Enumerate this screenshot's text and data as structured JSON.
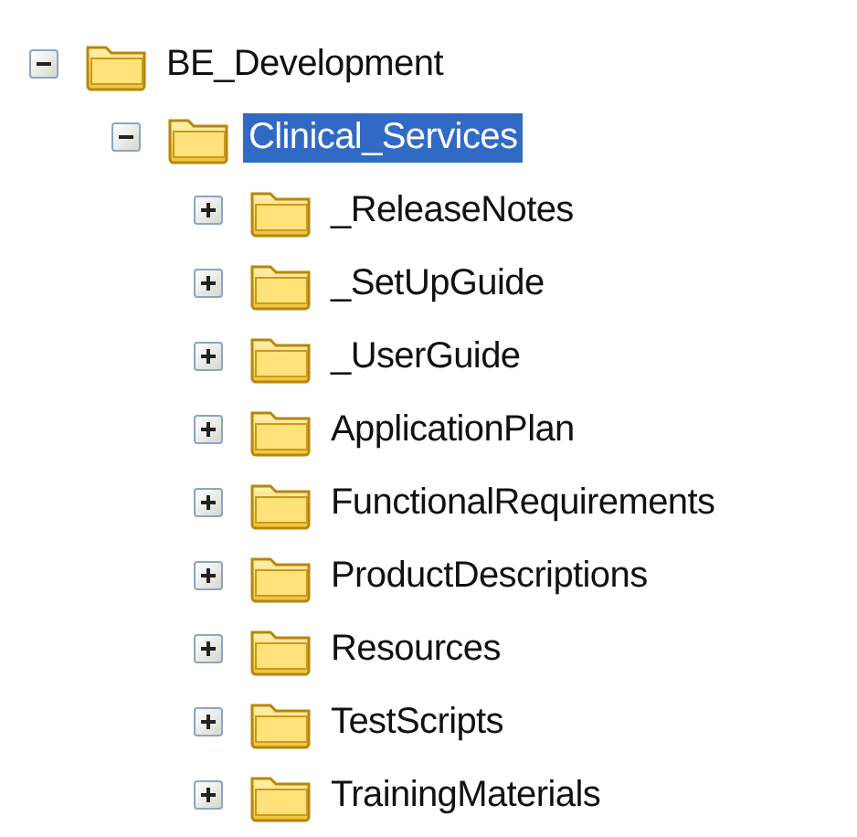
{
  "tree": [
    {
      "label": "BE_Development",
      "expanded": true,
      "selected": false,
      "children": [
        {
          "label": "Clinical_Services",
          "expanded": true,
          "selected": true,
          "children": [
            {
              "label": "_ReleaseNotes",
              "expanded": false,
              "selected": false
            },
            {
              "label": "_SetUpGuide",
              "expanded": false,
              "selected": false
            },
            {
              "label": "_UserGuide",
              "expanded": false,
              "selected": false
            },
            {
              "label": "ApplicationPlan",
              "expanded": false,
              "selected": false
            },
            {
              "label": "FunctionalRequirements",
              "expanded": false,
              "selected": false
            },
            {
              "label": "ProductDescriptions",
              "expanded": false,
              "selected": false
            },
            {
              "label": "Resources",
              "expanded": false,
              "selected": false
            },
            {
              "label": "TestScripts",
              "expanded": false,
              "selected": false
            },
            {
              "label": "TrainingMaterials",
              "expanded": false,
              "selected": false
            }
          ]
        }
      ]
    }
  ]
}
